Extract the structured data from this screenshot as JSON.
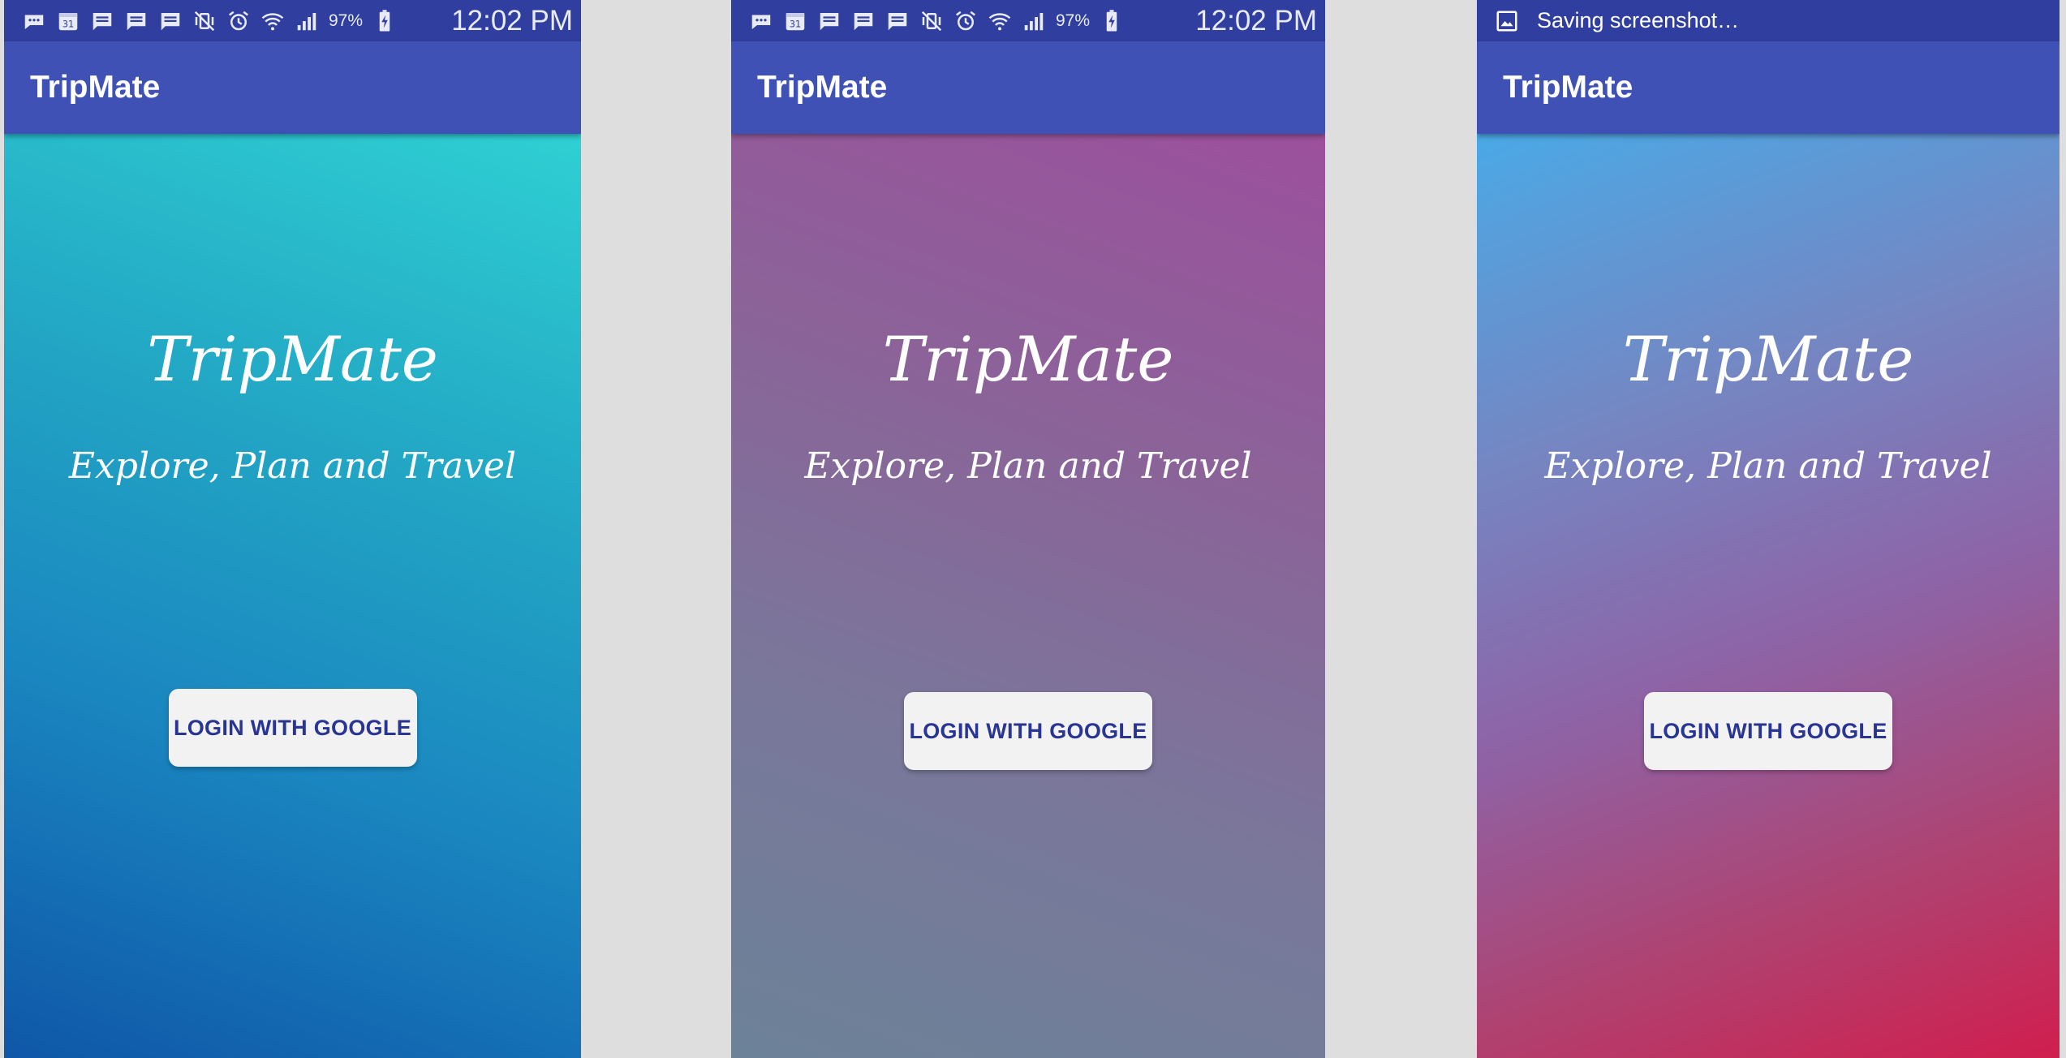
{
  "app_bar": {
    "title": "TripMate"
  },
  "hero": {
    "title": "TripMate",
    "subtitle": "Explore, Plan and Travel"
  },
  "login_button": {
    "label": "LOGIN WITH GOOGLE"
  },
  "status_bar": {
    "battery_percent": "97%",
    "time": "12:02 PM",
    "icons": [
      "chat-bubble-icon",
      "calendar-31-icon",
      "message-icon",
      "message-icon",
      "message-icon",
      "vibrate-mute-icon",
      "alarm-icon",
      "wifi-icon",
      "signal-icon",
      "battery-charging-icon"
    ],
    "calendar_day": "31"
  },
  "notification": {
    "icon": "image-icon",
    "text": "Saving screenshot…"
  },
  "colors": {
    "status_bar": "#303f9f",
    "app_bar": "#3f51b5",
    "button_text": "#283593",
    "button_bg": "#f2f2f2",
    "background": "#dedede"
  }
}
